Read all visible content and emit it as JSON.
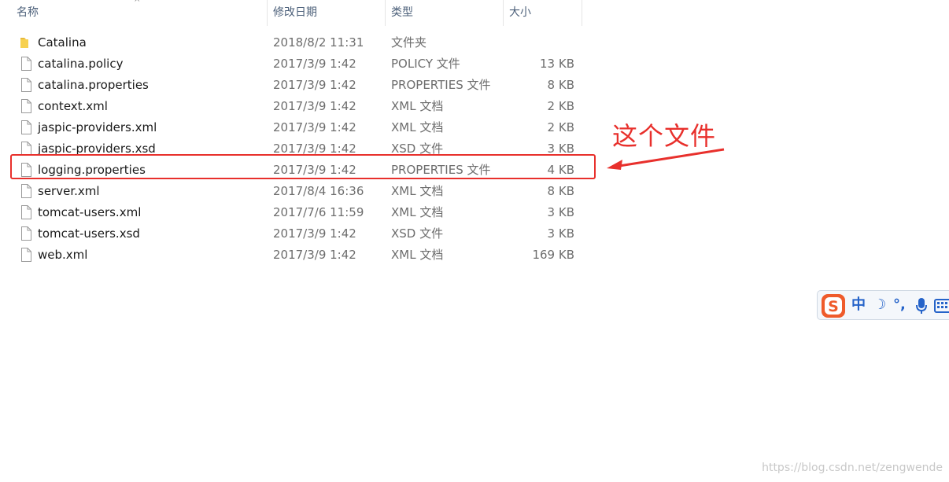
{
  "columns": {
    "name": "名称",
    "date": "修改日期",
    "type": "类型",
    "size": "大小"
  },
  "sort_indicator": "^",
  "files": [
    {
      "name": "Catalina",
      "date": "2018/8/2 11:31",
      "type": "文件夹",
      "size": "",
      "icon": "folder-icon"
    },
    {
      "name": "catalina.policy",
      "date": "2017/3/9 1:42",
      "type": "POLICY 文件",
      "size": "13 KB",
      "icon": "file-icon"
    },
    {
      "name": "catalina.properties",
      "date": "2017/3/9 1:42",
      "type": "PROPERTIES 文件",
      "size": "8 KB",
      "icon": "file-icon"
    },
    {
      "name": "context.xml",
      "date": "2017/3/9 1:42",
      "type": "XML 文档",
      "size": "2 KB",
      "icon": "file-icon"
    },
    {
      "name": "jaspic-providers.xml",
      "date": "2017/3/9 1:42",
      "type": "XML 文档",
      "size": "2 KB",
      "icon": "file-icon"
    },
    {
      "name": "jaspic-providers.xsd",
      "date": "2017/3/9 1:42",
      "type": "XSD 文件",
      "size": "3 KB",
      "icon": "file-icon"
    },
    {
      "name": "logging.properties",
      "date": "2017/3/9 1:42",
      "type": "PROPERTIES 文件",
      "size": "4 KB",
      "icon": "file-icon"
    },
    {
      "name": "server.xml",
      "date": "2017/8/4 16:36",
      "type": "XML 文档",
      "size": "8 KB",
      "icon": "file-icon"
    },
    {
      "name": "tomcat-users.xml",
      "date": "2017/7/6 11:59",
      "type": "XML 文档",
      "size": "3 KB",
      "icon": "file-icon"
    },
    {
      "name": "tomcat-users.xsd",
      "date": "2017/3/9 1:42",
      "type": "XSD 文件",
      "size": "3 KB",
      "icon": "file-icon"
    },
    {
      "name": "web.xml",
      "date": "2017/3/9 1:42",
      "type": "XML 文档",
      "size": "169 KB",
      "icon": "file-icon"
    }
  ],
  "annotation": {
    "text": "这个文件",
    "color": "#e8302c"
  },
  "ime": {
    "logo": "S",
    "mode": "中",
    "moon": "☽",
    "punct": "°,",
    "mic": "mic-icon",
    "keyboard": "keyboard-icon"
  },
  "watermark": "https://blog.csdn.net/zengwende"
}
